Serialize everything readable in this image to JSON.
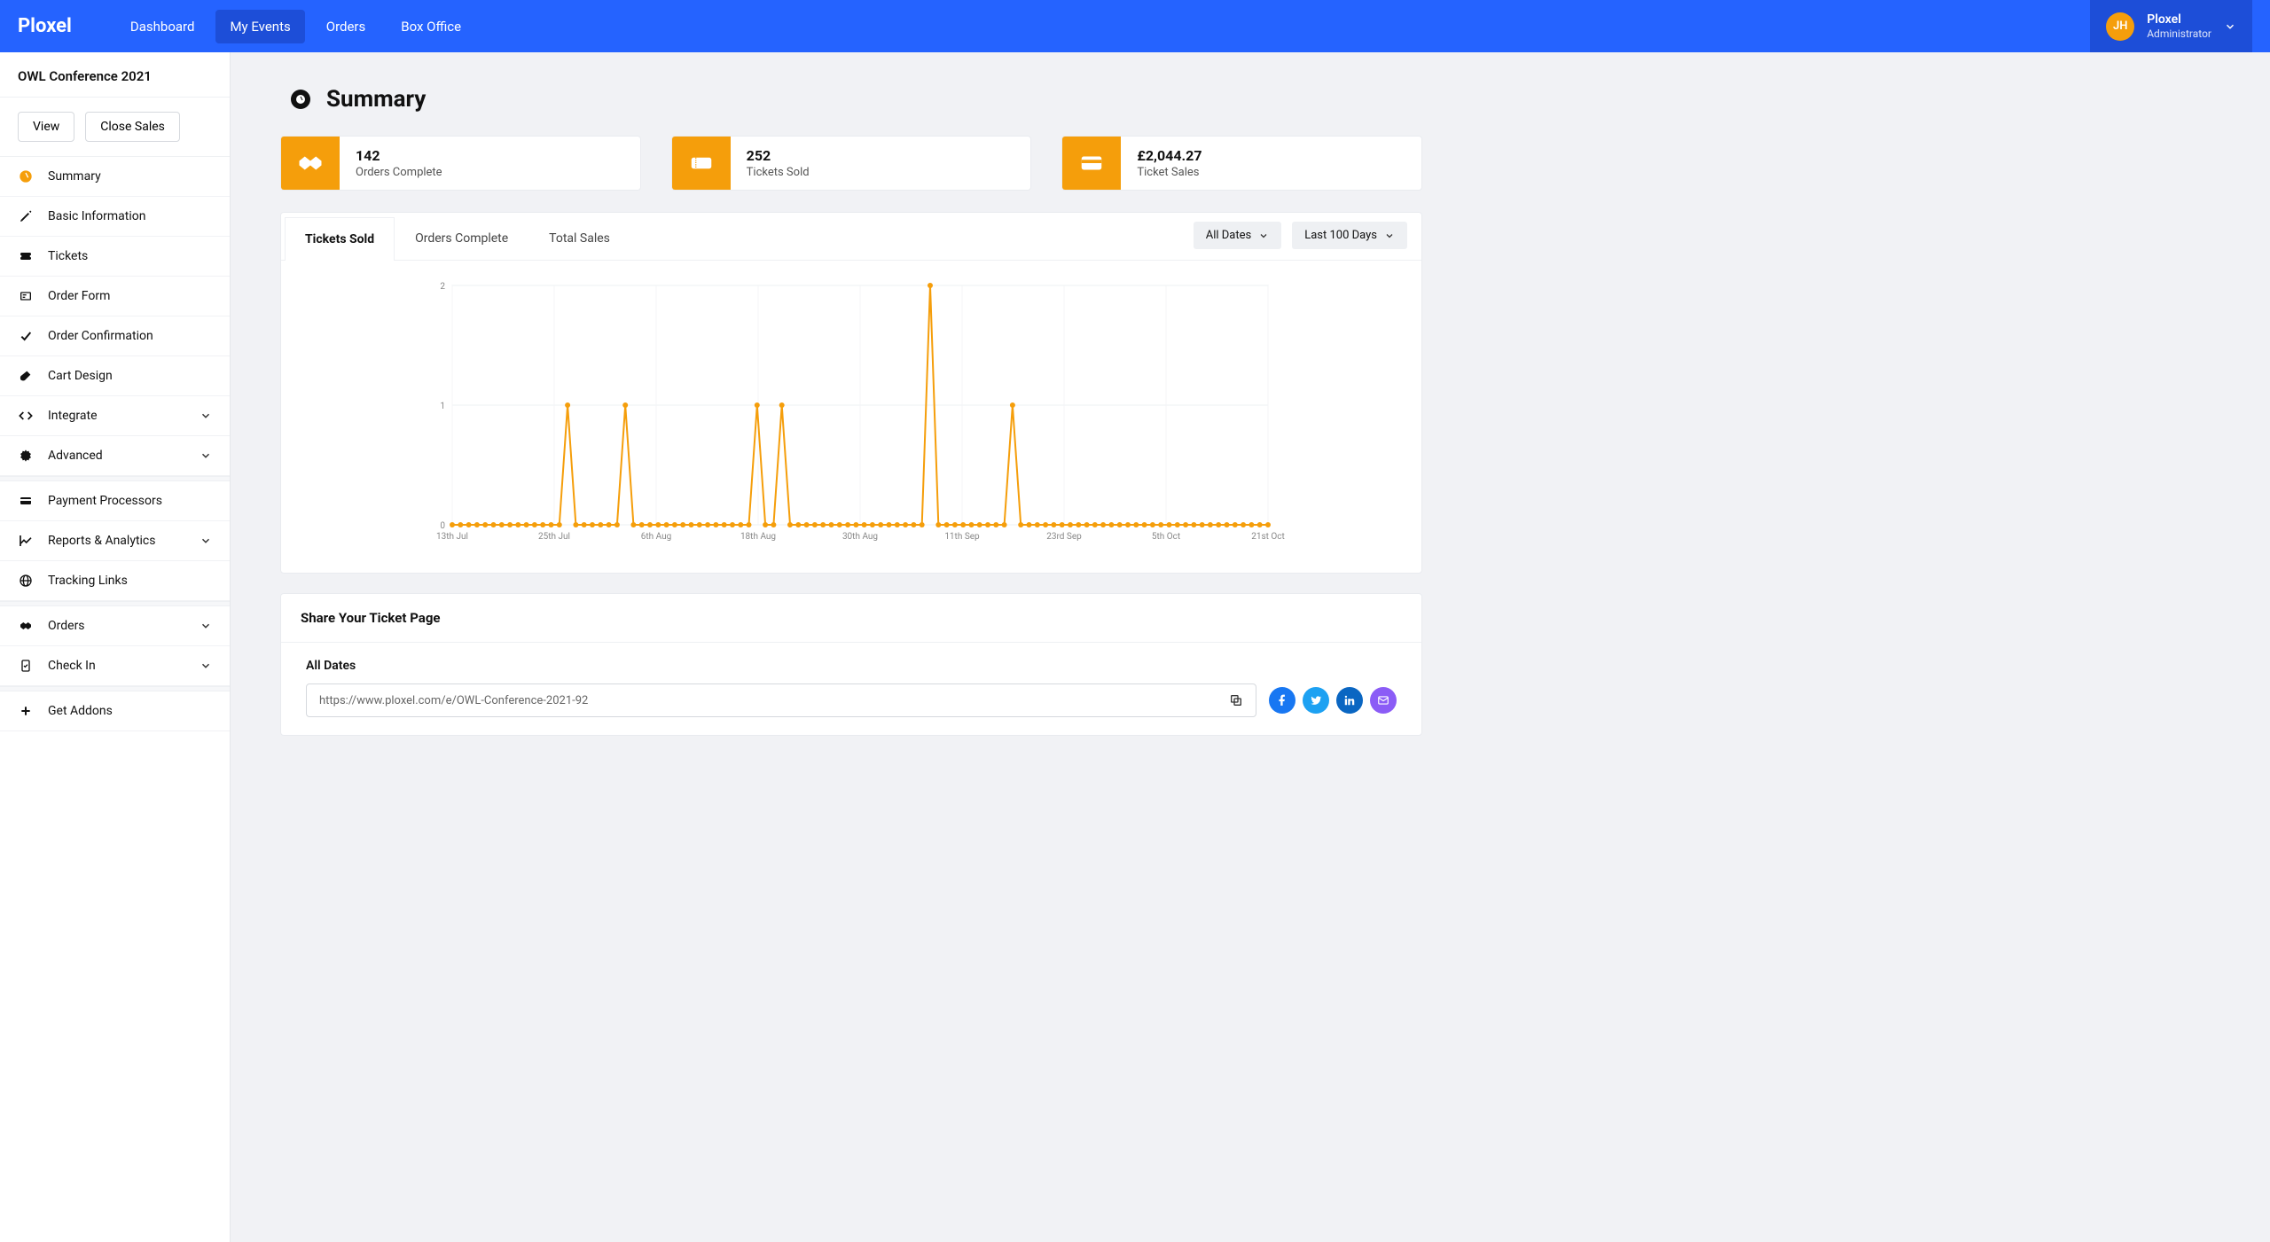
{
  "brand": "Ploxel",
  "nav": [
    "Dashboard",
    "My Events",
    "Orders",
    "Box Office"
  ],
  "nav_active": 1,
  "user": {
    "initials": "JH",
    "name": "Ploxel",
    "role": "Administrator"
  },
  "event_title": "OWL Conference 2021",
  "sidebar_buttons": {
    "view": "View",
    "close": "Close Sales"
  },
  "sidebar": [
    {
      "label": "Summary",
      "icon": "dashboard-icon",
      "active": true
    },
    {
      "label": "Basic Information",
      "icon": "pencil-icon"
    },
    {
      "label": "Tickets",
      "icon": "ticket-icon"
    },
    {
      "label": "Order Form",
      "icon": "form-icon"
    },
    {
      "label": "Order Confirmation",
      "icon": "check-icon"
    },
    {
      "label": "Cart Design",
      "icon": "brush-icon"
    },
    {
      "label": "Integrate",
      "icon": "code-icon",
      "chev": true
    },
    {
      "label": "Advanced",
      "icon": "gear-icon",
      "chev": true
    },
    {
      "sep": true
    },
    {
      "label": "Payment Processors",
      "icon": "card-icon"
    },
    {
      "label": "Reports & Analytics",
      "icon": "chart-icon",
      "chev": true
    },
    {
      "label": "Tracking Links",
      "icon": "globe-icon"
    },
    {
      "sep": true
    },
    {
      "label": "Orders",
      "icon": "handshake-icon",
      "chev": true
    },
    {
      "label": "Check In",
      "icon": "checkin-icon",
      "chev": true
    },
    {
      "sep": true
    },
    {
      "label": "Get Addons",
      "icon": "plus-icon"
    }
  ],
  "page_title": "Summary",
  "stats": [
    {
      "value": "142",
      "label": "Orders Complete",
      "icon": "handshake-icon"
    },
    {
      "value": "252",
      "label": "Tickets Sold",
      "icon": "ticket-icon"
    },
    {
      "value": "£2,044.27",
      "label": "Ticket Sales",
      "icon": "card-icon"
    }
  ],
  "chart_tabs": [
    "Tickets Sold",
    "Orders Complete",
    "Total Sales"
  ],
  "chart_tab_active": 0,
  "filters": {
    "dates": "All Dates",
    "range": "Last 100 Days"
  },
  "share": {
    "title": "Share Your Ticket Page",
    "section": "All Dates",
    "url": "https://www.ploxel.com/e/OWL-Conference-2021-92"
  },
  "chart_data": {
    "type": "line",
    "title": "",
    "xlabel": "",
    "ylabel": "",
    "ylim": [
      0,
      2
    ],
    "y_ticks": [
      0,
      1,
      2
    ],
    "x_tick_labels": [
      "13th Jul",
      "25th Jul",
      "6th Aug",
      "18th Aug",
      "30th Aug",
      "11th Sep",
      "23rd Sep",
      "5th Oct",
      "21st Oct"
    ],
    "series": [
      {
        "name": "Tickets Sold",
        "color": "#f59e0b",
        "values": [
          0,
          0,
          0,
          0,
          0,
          0,
          0,
          0,
          0,
          0,
          0,
          0,
          0,
          0,
          1,
          0,
          0,
          0,
          0,
          0,
          0,
          1,
          0,
          0,
          0,
          0,
          0,
          0,
          0,
          0,
          0,
          0,
          0,
          0,
          0,
          0,
          0,
          1,
          0,
          0,
          1,
          0,
          0,
          0,
          0,
          0,
          0,
          0,
          0,
          0,
          0,
          0,
          0,
          0,
          0,
          0,
          0,
          0,
          2,
          0,
          0,
          0,
          0,
          0,
          0,
          0,
          0,
          0,
          1,
          0,
          0,
          0,
          0,
          0,
          0,
          0,
          0,
          0,
          0,
          0,
          0,
          0,
          0,
          0,
          0,
          0,
          0,
          0,
          0,
          0,
          0,
          0,
          0,
          0,
          0,
          0,
          0,
          0,
          0,
          0
        ]
      }
    ]
  }
}
